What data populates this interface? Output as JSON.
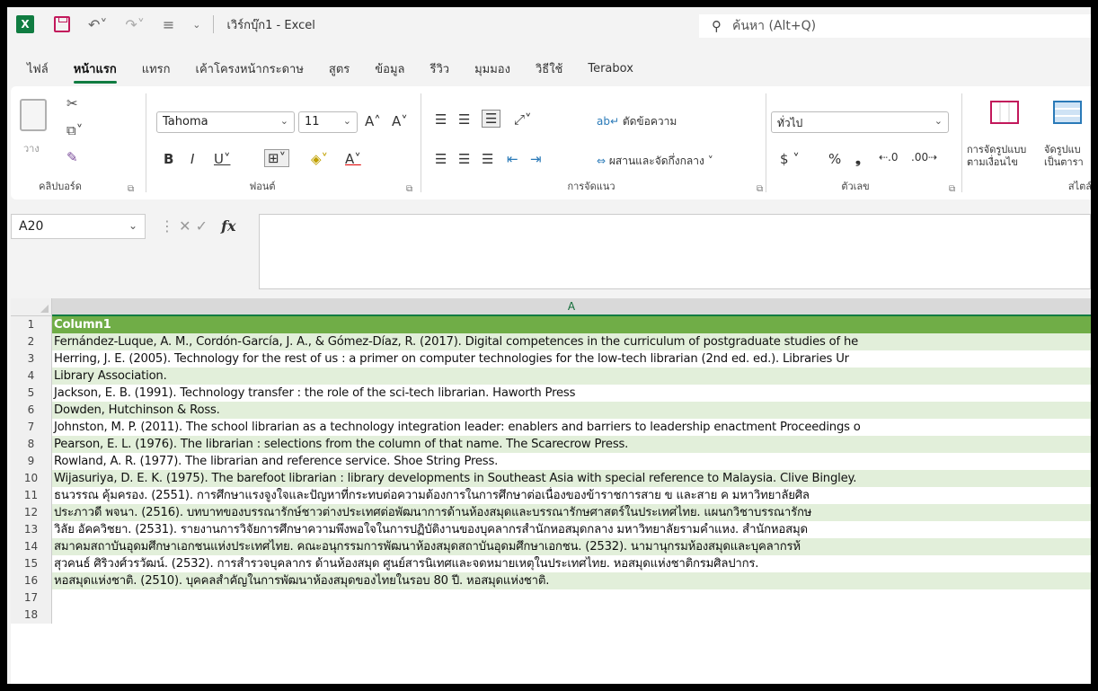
{
  "titlebar": {
    "app_icon": "X",
    "title": "เวิร์กบุ๊ก1  -  Excel",
    "search_placeholder": "ค้นหา (Alt+Q)"
  },
  "tabs": [
    "ไฟล์",
    "หน้าแรก",
    "แทรก",
    "เค้าโครงหน้ากระดาษ",
    "สูตร",
    "ข้อมูล",
    "รีวิว",
    "มุมมอง",
    "วิธีใช้",
    "Terabox"
  ],
  "active_tab": "หน้าแรก",
  "ribbon": {
    "clipboard": {
      "paste_label": "วาง",
      "group_label": "คลิปบอร์ด"
    },
    "font": {
      "font_name": "Tahoma",
      "font_size": "11",
      "group_label": "ฟอนต์"
    },
    "alignment": {
      "wrap_label": "ตัดข้อความ",
      "merge_label": "ผสานและจัดกึ่งกลาง",
      "group_label": "การจัดแนว"
    },
    "number": {
      "format": "ทั่วไป",
      "group_label": "ตัวเลข"
    },
    "styles": {
      "cond_format_line1": "การจัดรูปแบบ",
      "cond_format_line2": "ตามเงื่อนไข",
      "table_line1": "จัดรูปแบ",
      "table_line2": "เป็นตารา",
      "group_label": "สไตล์"
    }
  },
  "formula_bar": {
    "name_box": "A20",
    "formula": ""
  },
  "grid": {
    "column_header": "A",
    "rows": [
      {
        "num": "1",
        "text": "Column1",
        "style": "header"
      },
      {
        "num": "2",
        "text": "Fernández-Luque, A. M., Cordón-García, J. A., & Gómez-Díaz, R. (2017). Digital competences in the curriculum of postgraduate studies of he",
        "style": "band"
      },
      {
        "num": "3",
        "text": "Herring, J. E. (2005). Technology for the rest of us : a primer on computer technologies for the low-tech librarian (2nd ed. ed.). Libraries Ur",
        "style": "plain"
      },
      {
        "num": "4",
        "text": "Library Association.",
        "style": "band"
      },
      {
        "num": "5",
        "text": "Jackson, E. B. (1991). Technology transfer : the role of the sci-tech librarian. Haworth Press",
        "style": "plain"
      },
      {
        "num": "6",
        "text": "Dowden, Hutchinson & Ross.",
        "style": "band"
      },
      {
        "num": "7",
        "text": "Johnston, M. P. (2011). The school librarian as a technology integration leader: enablers and barriers to leadership enactment Proceedings o",
        "style": "plain"
      },
      {
        "num": "8",
        "text": "Pearson, E. L. (1976). The librarian : selections from the column of that name. The Scarecrow Press.",
        "style": "band"
      },
      {
        "num": "9",
        "text": "Rowland, A. R. (1977). The librarian and reference service. Shoe String Press.",
        "style": "plain"
      },
      {
        "num": "10",
        "text": "Wijasuriya, D. E. K. (1975). The barefoot librarian : library developments in Southeast Asia with special reference to Malaysia. Clive Bingley.",
        "style": "band"
      },
      {
        "num": "11",
        "text": "ธนวรรณ คุ้มครอง. (2551). การศึกษาแรงจูงใจและปัญหาที่กระทบต่อความต้องการในการศึกษาต่อเนื่องของข้าราชการสาย ข และสาย ค มหาวิทยาลัยศิล",
        "style": "plain"
      },
      {
        "num": "12",
        "text": "ประภาวดี พจนา. (2516). บทบาทของบรรณารักษ์ชาวต่างประเทศต่อพัฒนาการด้านห้องสมุดและบรรณารักษศาสตร์ในประเทศไทย. แผนกวิชาบรรณารักษ",
        "style": "band"
      },
      {
        "num": "13",
        "text": "วิลัย อัคควิชยา. (2531). รายงานการวิจัยการศึกษาความพึงพอใจในการปฏิบัติงานของบุคลากรสำนักหอสมุดกลาง มหาวิทยาลัยรามคำแหง. สำนักหอสมุด",
        "style": "plain"
      },
      {
        "num": "14",
        "text": "สมาคมสถาบันอุดมศึกษาเอกชนแห่งประเทศไทย. คณะอนุกรรมการพัฒนาห้องสมุดสถาบันอุดมศึกษาเอกชน. (2532). นามานุกรมห้องสมุดและบุคลากรห้",
        "style": "band"
      },
      {
        "num": "15",
        "text": "สุวคนธ์ ศิริวงศ์วรวัฒน์. (2532). การสำรวจบุคลากร ด้านห้องสมุด ศูนย์สารนิเทศและจดหมายเหตุในประเทศไทย. หอสมุดแห่งชาติกรมศิลปากร.",
        "style": "plain"
      },
      {
        "num": "16",
        "text": "หอสมุดแห่งชาติ. (2510). บุคคลสำคัญในการพัฒนาห้องสมุดของไทยในรอบ 80 ปี. หอสมุดแห่งชาติ.",
        "style": "band"
      },
      {
        "num": "17",
        "text": "",
        "style": "empty"
      },
      {
        "num": "18",
        "text": "",
        "style": "empty"
      }
    ]
  },
  "colors": {
    "accent": "#107c41",
    "header_fill": "#70ad47",
    "band_fill": "#e2efda"
  }
}
